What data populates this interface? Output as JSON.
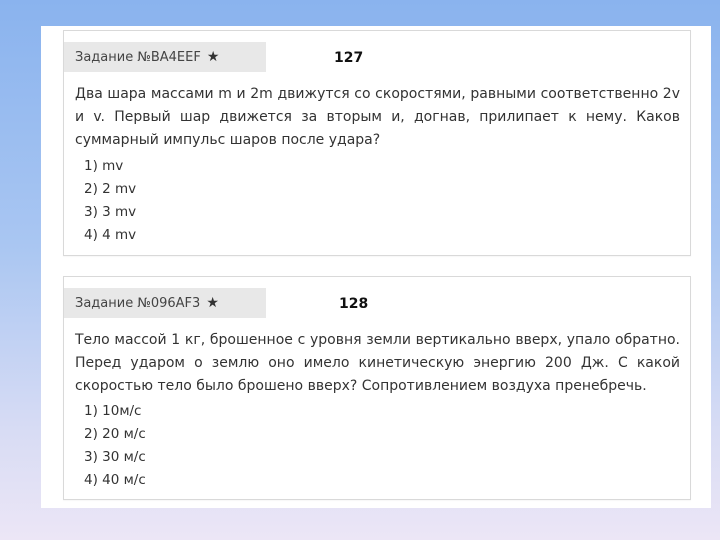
{
  "tasks": [
    {
      "header": "Задание №BA4EEF",
      "number": "127",
      "question": "Два шара массами m и 2m движутся со скоростями, равными соответственно 2v и v. Первый шар движется за вторым и, догнав, прилипает к нему. Каков суммарный импульс шаров после удара?",
      "options": [
        "1) mv",
        "2) 2 mv",
        "3) 3 mv",
        "4) 4 mv"
      ]
    },
    {
      "header": "Задание №096AF3",
      "number": "128",
      "question": "Тело массой 1 кг, брошенное с уровня земли вертикально вверх, упало обратно. Перед ударом о землю оно имело кинетическую энергию 200 Дж. С какой скоростью тело было брошено вверх? Сопротивлением воздуха пренебречь.",
      "options": [
        "1) 10м/с",
        "2) 20 м/с",
        "3) 30 м/с",
        "4) 40 м/с"
      ]
    }
  ],
  "icons": {
    "favorite": "star-icon"
  }
}
